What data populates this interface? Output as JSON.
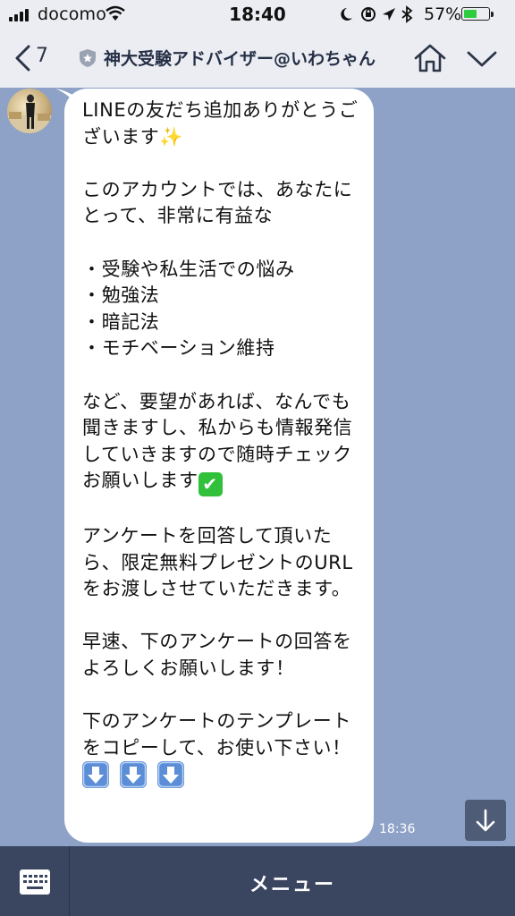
{
  "status_bar": {
    "carrier": "docomo",
    "time": "18:40",
    "battery_percent": "57%",
    "battery_level": 0.57
  },
  "header": {
    "unread_count": "7",
    "title": "神大受験アドバイザー@いわちゃん"
  },
  "message": {
    "paragraphs": [
      "LINEの友だち追加ありがとうございます",
      "このアカウントでは、あなたにとって、非常に有益な",
      "・受験や私生活での悩み\n・勉強法\n・暗記法\n・モチベーション維持",
      "など、要望があれば、なんでも聞きますし、私からも情報発信していきますので随時チェックお願いします",
      "アンケートを回答して頂いたら、限定無料プレゼントのURLをお渡しさせていただきます。",
      "早速、下のアンケートの回答をよろしくお願いします！",
      "下のアンケートのテンプレートをコピーして、お使い下さい！"
    ],
    "sparkle_emoji": "✨",
    "check_emoji": "✔",
    "timestamp": "18:36"
  },
  "footer": {
    "menu_label": "メニュー"
  },
  "colors": {
    "chat_background": "#8da2c6",
    "bubble": "#ffffff",
    "footer": "#3a4560",
    "battery": "#2ecc40"
  },
  "icons": [
    "signal-icon",
    "wifi-icon",
    "moon-icon",
    "orientation-lock-icon",
    "location-icon",
    "bluetooth-icon",
    "battery-icon",
    "back-chevron-icon",
    "shield-badge-icon",
    "home-icon",
    "chevron-down-icon",
    "down-arrow-icon",
    "keyboard-icon"
  ]
}
